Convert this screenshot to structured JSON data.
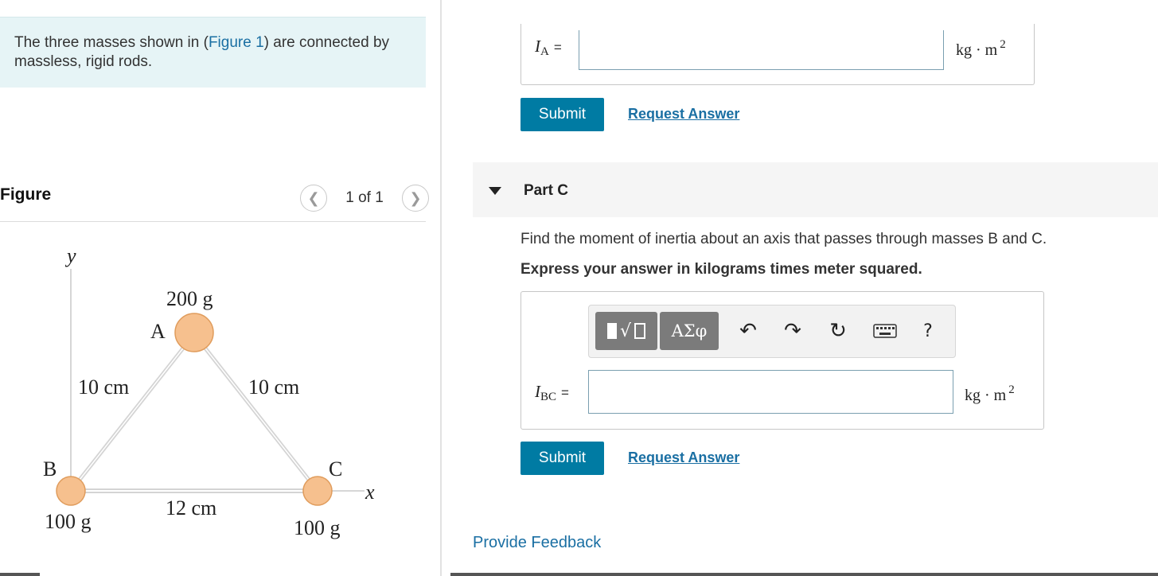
{
  "intro": {
    "text_before": "The three masses shown in (",
    "figure_link": "Figure 1",
    "text_after": ") are connected by massless, rigid rods."
  },
  "figure_panel": {
    "title": "Figure",
    "pager_text": "1 of 1",
    "prev_icon": "chevron-left-icon",
    "next_icon": "chevron-right-icon"
  },
  "diagram": {
    "y_axis_label": "y",
    "x_axis_label": "x",
    "mass_a": {
      "letter": "A",
      "mass": "200 g"
    },
    "mass_b": {
      "letter": "B",
      "mass": "100 g"
    },
    "mass_c": {
      "letter": "C",
      "mass": "100 g"
    },
    "rod_ab": "10 cm",
    "rod_ac": "10 cm",
    "rod_bc": "12 cm",
    "mass_color": "#f6c08e",
    "rod_color": "#d4d4d4"
  },
  "part_b": {
    "var_symbol": "I",
    "var_sub": "A",
    "equals": "=",
    "input_value": "",
    "unit_text": "kg · m",
    "unit_exp": "2",
    "submit_label": "Submit",
    "request_label": "Request Answer"
  },
  "part_c": {
    "title": "Part C",
    "question": "Find the moment of inertia about an axis that passes through masses B and C.",
    "instruction": "Express your answer in kilograms times meter squared.",
    "var_symbol": "I",
    "var_sub": "BC",
    "equals": "=",
    "input_value": "",
    "unit_text": "kg · m",
    "unit_exp": "2",
    "submit_label": "Submit",
    "request_label": "Request Answer",
    "toolbar": {
      "greek_label": "ΑΣφ",
      "help_label": "?",
      "icons": [
        "templates-icon",
        "greek-letters-icon",
        "undo-icon",
        "redo-icon",
        "reset-icon",
        "keyboard-icon",
        "help-icon"
      ]
    }
  },
  "feedback_label": "Provide Feedback",
  "colors": {
    "accent": "#007ba3",
    "link": "#1a6fa3",
    "intro_bg": "#e6f4f6"
  }
}
